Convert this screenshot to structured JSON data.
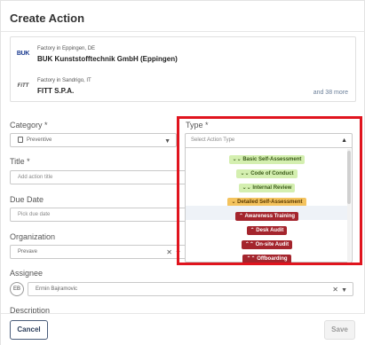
{
  "dialog": {
    "title": "Create Action"
  },
  "factories": [
    {
      "logo": "BUK",
      "subtitle": "Factory in Eppingen, DE",
      "name": "BUK Kunststofftechnik GmbH (Eppingen)"
    },
    {
      "logo": "FiTT",
      "subtitle": "Factory in Sandrigo, IT",
      "name": "FITT S.P.A."
    }
  ],
  "factories_more": "and 38 more",
  "category": {
    "label": "Category *",
    "value": "Preventive",
    "icon": "clipboard-icon"
  },
  "type": {
    "label": "Type *",
    "placeholder": "Select Action Type",
    "options": [
      {
        "label": "Basic Self-Assessment",
        "color": "#d4efb0",
        "icon": "double-chevron-down-icon"
      },
      {
        "label": "Code of Conduct",
        "color": "#d4efb0",
        "icon": "double-chevron-down-icon"
      },
      {
        "label": "Internal Review",
        "color": "#d4efb0",
        "icon": "double-chevron-down-icon"
      },
      {
        "label": "Detailed Self-Assessment",
        "color": "#f4c35e",
        "icon": "chevron-down-icon"
      },
      {
        "label": "Awareness Training",
        "color": "#a4252d",
        "icon": "chevron-up-icon"
      },
      {
        "label": "Desk Audit",
        "color": "#a4252d",
        "icon": "chevron-up-icon"
      },
      {
        "label": "On-site Audit",
        "color": "#a4252d",
        "icon": "double-chevron-up-icon"
      },
      {
        "label": "Offboarding",
        "color": "#a4252d",
        "icon": "double-chevron-up-icon"
      }
    ]
  },
  "title_field": {
    "label": "Title *",
    "placeholder": "Add action title"
  },
  "due_date": {
    "label": "Due Date",
    "placeholder": "Pick due date"
  },
  "organization": {
    "label": "Organization",
    "value": "Prevave"
  },
  "assignee": {
    "label": "Assignee",
    "initials": "EB",
    "value": "Ermin Bajramovic"
  },
  "description": {
    "label": "Description"
  },
  "footer": {
    "cancel": "Cancel",
    "save": "Save"
  },
  "colors": {
    "highlight_border": "#e0141e",
    "primary": "#2d3f5c"
  }
}
